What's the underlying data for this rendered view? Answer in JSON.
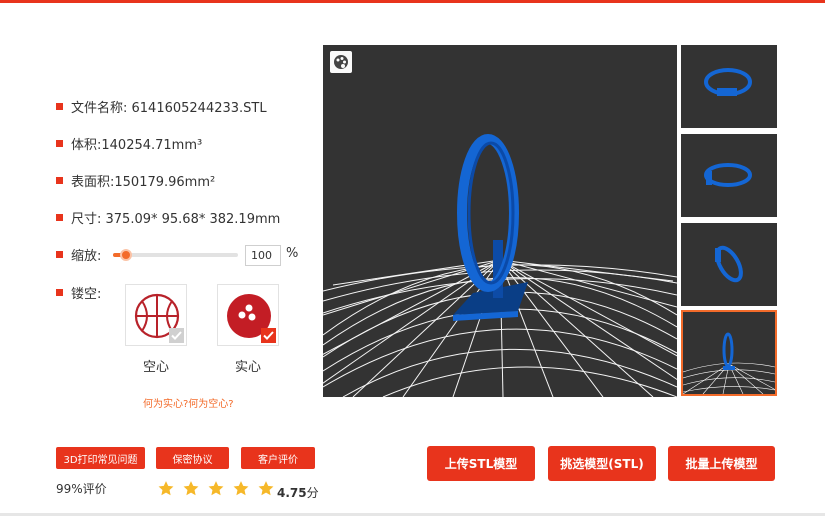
{
  "file_info": {
    "name": "文件名称:   6141605244233.STL",
    "volume": "体积:140254.71mm³",
    "area": "表面积:150179.96mm²",
    "size": "尺寸: 375.09* 95.68* 382.19mm"
  },
  "scale": {
    "label": "缩放:",
    "value": "100",
    "unit": "%",
    "slider_fraction": 0.1
  },
  "hollow": {
    "label": "镂空:",
    "options": [
      {
        "label": "空心",
        "selected": false
      },
      {
        "label": "实心",
        "selected": true
      }
    ],
    "help_link": "何为实心?何为空心?"
  },
  "links": {
    "faq": "3D打印常见问题",
    "privacy": "保密协议",
    "reviews": "客户评价"
  },
  "rating": {
    "percent_text": "99%评价",
    "score": "4.75",
    "unit": "分",
    "stars": 5
  },
  "actions": {
    "upload": "上传STL模型",
    "select": "挑选模型(STL)",
    "batch": "批量上传模型"
  },
  "colors": {
    "accent": "#e8341c",
    "slider": "#f36b2a",
    "star": "#f6b829",
    "model": "#1466d4",
    "viewer_bg": "#333333"
  },
  "icons": {
    "palette": "palette-icon",
    "hollow": "basketball-icon",
    "solid": "bowling-ball-icon",
    "check": "check-icon",
    "star": "star-icon"
  }
}
